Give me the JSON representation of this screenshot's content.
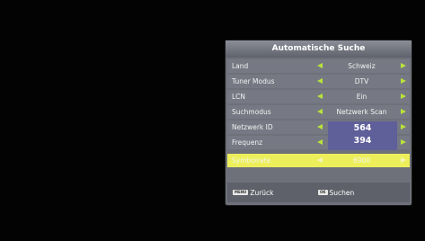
{
  "menu": {
    "title": "Automatische Suche",
    "rows": [
      {
        "label": "Land",
        "value": "Schweiz"
      },
      {
        "label": "Tuner Modus",
        "value": "DTV"
      },
      {
        "label": "LCN",
        "value": "Ein"
      },
      {
        "label": "Suchmodus",
        "value": "Netzwerk Scan"
      },
      {
        "label": "Netzwerk ID",
        "value": ""
      },
      {
        "label": "Frequenz",
        "value": ""
      },
      {
        "label": "Symbolrate",
        "value": "6900"
      }
    ],
    "popup": {
      "network_id": "564",
      "frequency": "394"
    },
    "footer": {
      "back_key": "MENU",
      "back_label": "Zurück",
      "search_key": "OK",
      "search_label": "Suchen"
    }
  },
  "colors": {
    "accent": "#b9e33b",
    "selected_row": "#ecef5a",
    "popup": "#5f5f9a",
    "panel": "#6e7179"
  }
}
